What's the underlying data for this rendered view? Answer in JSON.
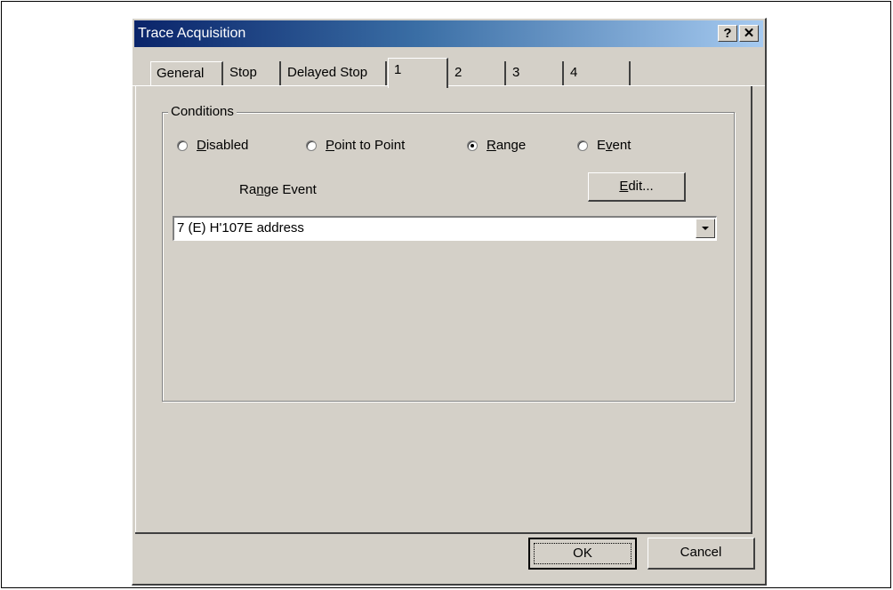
{
  "window": {
    "title": "Trace Acquisition",
    "help_button": "?",
    "close_button": "✕"
  },
  "tabs": [
    {
      "label": "General"
    },
    {
      "label": "Stop"
    },
    {
      "label": "Delayed Stop"
    },
    {
      "label": "1",
      "active": true
    },
    {
      "label": "2"
    },
    {
      "label": "3"
    },
    {
      "label": "4"
    }
  ],
  "conditions": {
    "legend": "Conditions",
    "options": [
      {
        "label_pre": "",
        "mnemonic": "D",
        "label_post": "isabled",
        "checked": false
      },
      {
        "label_pre": "",
        "mnemonic": "P",
        "label_post": "oint to Point",
        "checked": false
      },
      {
        "label_pre": "",
        "mnemonic": "R",
        "label_post": "ange",
        "checked": true
      },
      {
        "label_pre": "E",
        "mnemonic": "v",
        "label_post": "ent",
        "checked": false
      }
    ],
    "range_event_label_pre": "Ra",
    "range_event_label_mnemonic": "n",
    "range_event_label_post": "ge Event",
    "edit_button_mnemonic": "E",
    "edit_button_post": "dit...",
    "range_event_value": "7 (E) H'107E address"
  },
  "buttons": {
    "ok": "OK",
    "cancel": "Cancel"
  }
}
